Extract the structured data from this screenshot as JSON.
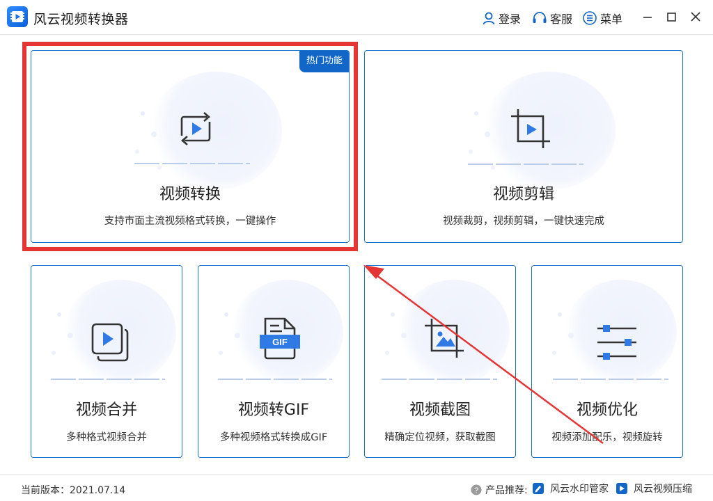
{
  "titlebar": {
    "app_title": "风云视频转换器",
    "login_label": "登录",
    "service_label": "客服",
    "menu_label": "菜单"
  },
  "cards": {
    "convert": {
      "badge": "热门功能",
      "title": "视频转换",
      "desc": "支持市面主流视频格式转换，一键操作"
    },
    "edit": {
      "title": "视频剪辑",
      "desc": "视频裁剪，视频剪辑，一键快速完成"
    },
    "merge": {
      "title": "视频合并",
      "desc": "多种格式视频合并"
    },
    "gif": {
      "title": "视频转GIF",
      "desc": "多种视频格式转换成GIF",
      "icon_text": "GIF"
    },
    "screenshot": {
      "title": "视频截图",
      "desc": "精确定位视频，获取截图"
    },
    "optimize": {
      "title": "视频优化",
      "desc": "视频添加配乐，视频旋转"
    }
  },
  "footer": {
    "version": "当前版本：2021.07.14",
    "recommend_label": "产品推荐:",
    "product_1": "风云水印管家",
    "product_2": "风云视频压缩"
  },
  "colors": {
    "accent": "#1266c7",
    "card_border": "#1a73c9",
    "annotation": "#e53434",
    "icon_play": "#2f7ae5"
  }
}
